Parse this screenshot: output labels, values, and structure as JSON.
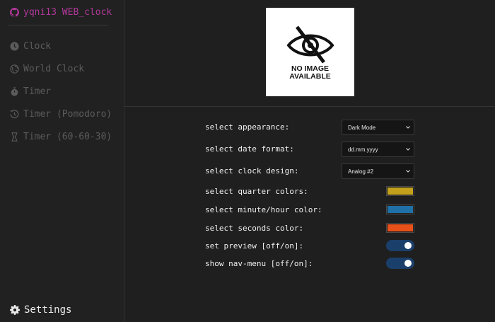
{
  "sidebar": {
    "brand": "yqni13 WEB_clock",
    "items": [
      {
        "label": "Clock"
      },
      {
        "label": "World Clock"
      },
      {
        "label": "Timer"
      },
      {
        "label": "Timer (Pomodoro)"
      },
      {
        "label": "Timer (60-60-30)"
      }
    ],
    "settings_label": "Settings"
  },
  "preview": {
    "line1": "NO IMAGE",
    "line2": "AVAILABLE"
  },
  "settings": {
    "appearance": {
      "label": "select appearance:",
      "value": "Dark Mode"
    },
    "date_format": {
      "label": "select date format:",
      "value": "dd.mm.yyyy"
    },
    "clock_design": {
      "label": "select clock design:",
      "value": "Analog #2"
    },
    "quarter_colors": {
      "label": "select quarter colors:",
      "color": "#c4a11c"
    },
    "minute_hour_color": {
      "label": "select minute/hour color:",
      "color": "#1f70a6"
    },
    "seconds_color": {
      "label": "select seconds color:",
      "color": "#e8501a"
    },
    "preview_toggle": {
      "label": "set preview [off/on]:",
      "state": "on"
    },
    "nav_menu_toggle": {
      "label": "show nav-menu [off/on]:",
      "state": "on"
    }
  }
}
